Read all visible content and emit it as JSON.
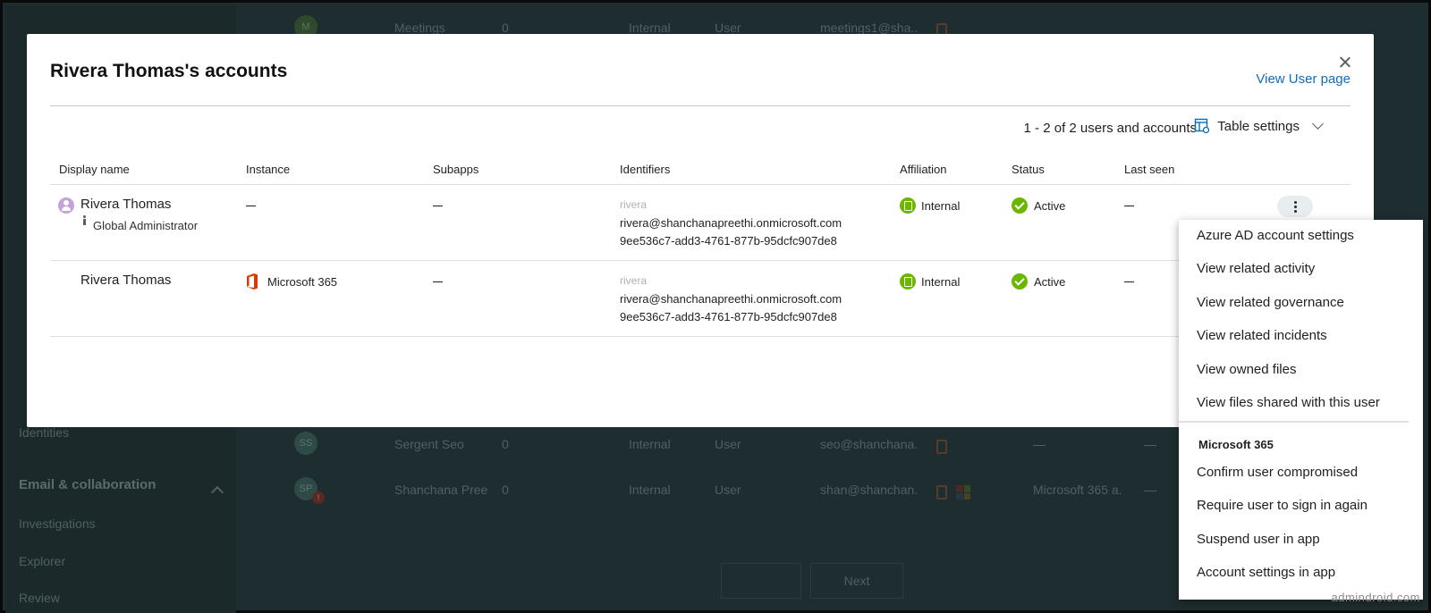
{
  "background": {
    "nav": {
      "identities": "Identities",
      "section_email": "Email & collaboration",
      "investigations": "Investigations",
      "explorer": "Explorer",
      "review": "Review"
    },
    "rows": [
      {
        "avatar": "M",
        "name": "Meetings",
        "count": "0",
        "affiliation": "Internal",
        "type": "User",
        "email": "meetings1@sha...",
        "status": "—",
        "last": "—"
      },
      {
        "avatar": "SS",
        "name": "Sergent Seo",
        "count": "0",
        "affiliation": "Internal",
        "type": "User",
        "email": "seo@shanchana...",
        "status": "—",
        "last": "—"
      },
      {
        "avatar": "SP",
        "name": "Shanchana Pree",
        "count": "0",
        "affiliation": "Internal",
        "type": "User",
        "email": "shan@shanchan...",
        "status": "Microsoft 365 a...",
        "last": "—"
      }
    ],
    "pager": {
      "next": "Next"
    }
  },
  "modal": {
    "title": "Rivera Thomas's accounts",
    "view_user_link": "View User page",
    "count_text": "1 - 2 of 2 users and accounts",
    "table_settings": "Table settings",
    "columns": {
      "display_name": "Display name",
      "instance": "Instance",
      "subapps": "Subapps",
      "identifiers": "Identifiers",
      "affiliation": "Affiliation",
      "status": "Status",
      "last_seen": "Last seen"
    },
    "rows": [
      {
        "display_name": "Rivera Thomas",
        "role": "Global Administrator",
        "instance": "",
        "id_alias": "rivera",
        "id_email": "rivera@shanchanapreethi.onmicrosoft.com",
        "id_guid": "9ee536c7-add3-4761-877b-95dcfc907de8",
        "affiliation": "Internal",
        "status": "Active"
      },
      {
        "display_name": "Rivera Thomas",
        "role": "",
        "instance": "Microsoft 365",
        "id_alias": "rivera",
        "id_email": "rivera@shanchanapreethi.onmicrosoft.com",
        "id_guid": "9ee536c7-add3-4761-877b-95dcfc907de8",
        "affiliation": "Internal",
        "status": "Active"
      }
    ]
  },
  "context_menu": {
    "items": [
      "Azure AD account settings",
      "View related activity",
      "View related governance",
      "View related incidents",
      "View owned files",
      "View files shared with this user"
    ],
    "section_header": "Microsoft 365",
    "section_items": [
      "Confirm user compromised",
      "Require user to sign in again",
      "Suspend user in app",
      "Account settings in app"
    ]
  },
  "watermark": "admindroid.com",
  "colors": {
    "link": "#0f6cbd",
    "status_green": "#6bb700",
    "office_red": "#d83b01"
  }
}
